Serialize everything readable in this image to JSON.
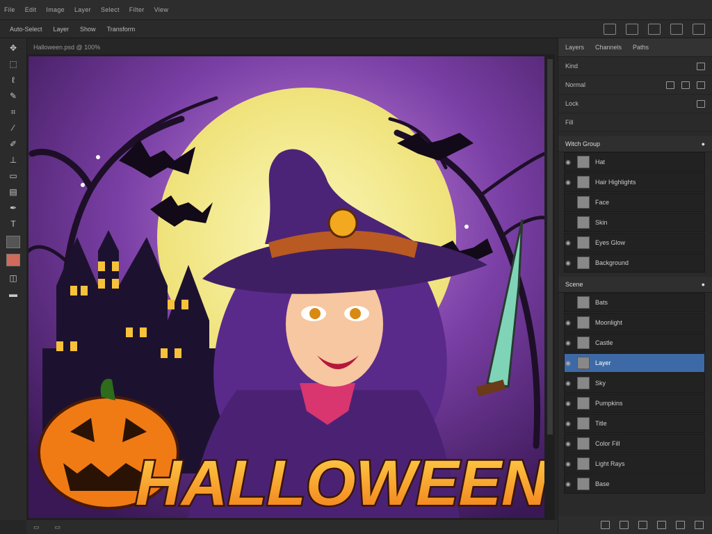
{
  "menubar": {
    "items": [
      "File",
      "Edit",
      "Image",
      "Layer",
      "Select",
      "Filter",
      "View"
    ]
  },
  "options": {
    "items": [
      "Auto-Select",
      "Layer",
      "Show",
      "Transform"
    ]
  },
  "toolbar": {
    "tools": [
      "move-tool",
      "marquee-tool",
      "lasso-tool",
      "quick-select-tool",
      "crop-tool",
      "eyedropper-tool",
      "brush-tool",
      "stamp-tool",
      "eraser-tool",
      "gradient-tool",
      "pen-tool",
      "text-tool"
    ]
  },
  "document": {
    "tab_title": "Halloween.psd @ 100%"
  },
  "artwork": {
    "title_text": "HALLOWEEN"
  },
  "colors": {
    "accent": "#3d6aa6",
    "panel_bg": "#2a2a2a",
    "canvas_bg": "#1f1f1f",
    "moon": "#f3ef8a",
    "sky": "#7a3fa5"
  },
  "panels": {
    "tabs": [
      "Layers",
      "Channels",
      "Paths"
    ],
    "rows": [
      {
        "label": "Kind"
      },
      {
        "label": "Normal"
      },
      {
        "label": "Lock"
      },
      {
        "label": "Fill"
      }
    ],
    "group1": {
      "name": "Witch Group"
    },
    "layers1": [
      {
        "name": "Hat",
        "visible": true
      },
      {
        "name": "Hair Highlights",
        "visible": true
      },
      {
        "name": "Face",
        "visible": false
      },
      {
        "name": "Skin",
        "visible": false
      },
      {
        "name": "Eyes Glow",
        "visible": true
      },
      {
        "name": "Background",
        "visible": true
      }
    ],
    "group2": {
      "name": "Scene"
    },
    "layers2": [
      {
        "name": "Bats",
        "visible": false
      },
      {
        "name": "Moonlight",
        "visible": true
      },
      {
        "name": "Castle",
        "visible": true
      },
      {
        "name": "Layer",
        "visible": true,
        "selected": true
      },
      {
        "name": "Sky",
        "visible": true
      },
      {
        "name": "Pumpkins",
        "visible": true
      },
      {
        "name": "Title",
        "visible": true
      },
      {
        "name": "Color Fill",
        "visible": true
      },
      {
        "name": "Light Rays",
        "visible": true
      },
      {
        "name": "Base",
        "visible": true
      }
    ]
  }
}
